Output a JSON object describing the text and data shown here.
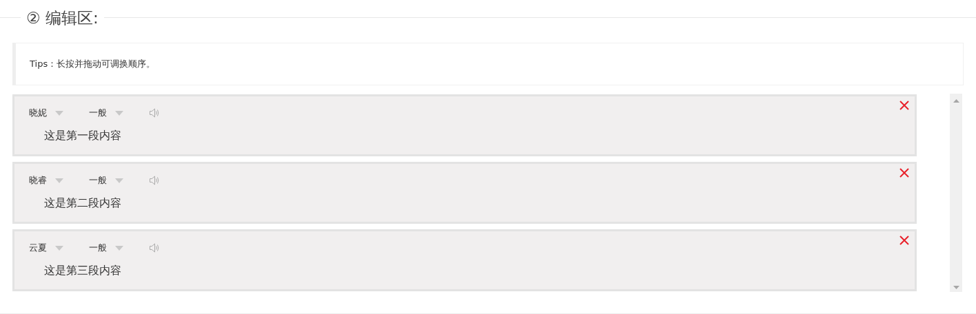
{
  "section": {
    "title": "② 编辑区:"
  },
  "tips": {
    "text": "Tips：长按并拖动可调换顺序。"
  },
  "paragraphs": [
    {
      "speaker": "晓妮",
      "style": "一般",
      "content": "这是第一段内容"
    },
    {
      "speaker": "晓睿",
      "style": "一般",
      "content": "这是第二段内容"
    },
    {
      "speaker": "云夏",
      "style": "一般",
      "content": "这是第三段内容"
    }
  ]
}
